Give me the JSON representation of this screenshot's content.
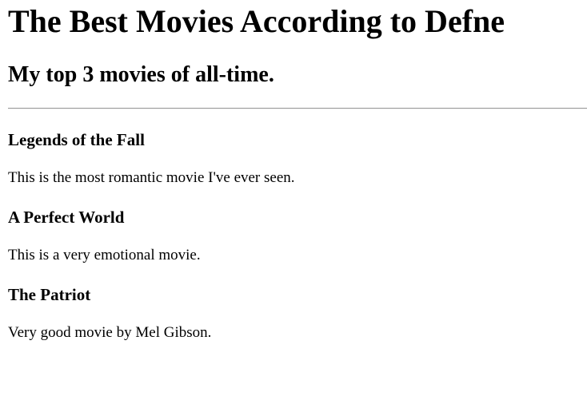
{
  "page": {
    "title": "The Best Movies According to Defne",
    "subtitle": "My top 3 movies of all-time."
  },
  "movies": [
    {
      "title": "Legends of the Fall",
      "description": "This is the most romantic movie I've ever seen."
    },
    {
      "title": "A Perfect World",
      "description": "This is a very emotional movie."
    },
    {
      "title": "The Patriot",
      "description": "Very good movie by Mel Gibson."
    }
  ]
}
